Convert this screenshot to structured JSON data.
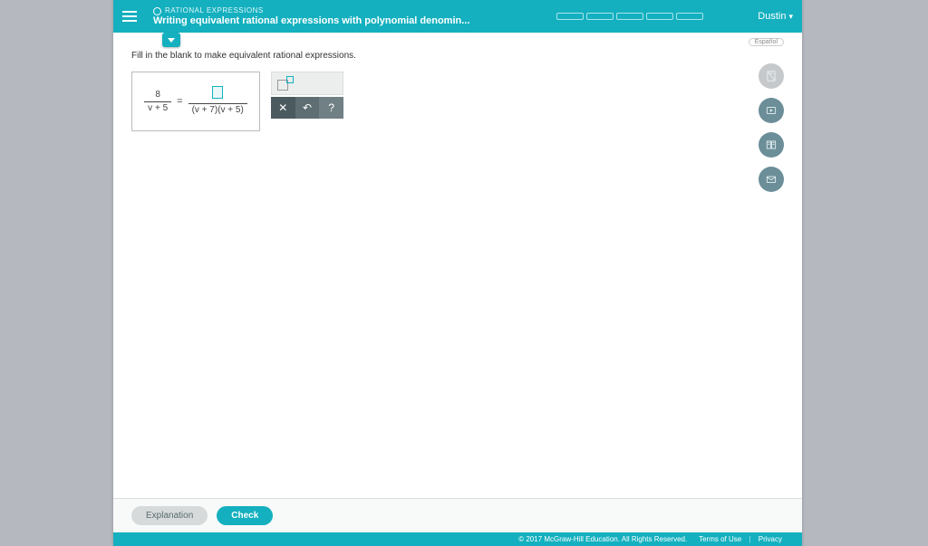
{
  "header": {
    "category": "RATIONAL EXPRESSIONS",
    "title": "Writing equivalent rational expressions with polynomial denomin...",
    "user": "Dustin",
    "language": "Español"
  },
  "question": {
    "instructions": "Fill in the blank to make equivalent rational expressions.",
    "left": {
      "numerator": "8",
      "denominator": "v + 5"
    },
    "equals": "=",
    "right": {
      "numerator_blank": true,
      "denominator": "(v + 7)(v + 5)"
    }
  },
  "tools": {
    "clear": "✕",
    "undo": "↶",
    "help": "?"
  },
  "sidetools": [
    "calculator",
    "video",
    "textbook",
    "mail"
  ],
  "footer": {
    "explanation": "Explanation",
    "check": "Check",
    "copyright": "© 2017 McGraw-Hill Education. All Rights Reserved.",
    "terms": "Terms of Use",
    "privacy": "Privacy"
  }
}
